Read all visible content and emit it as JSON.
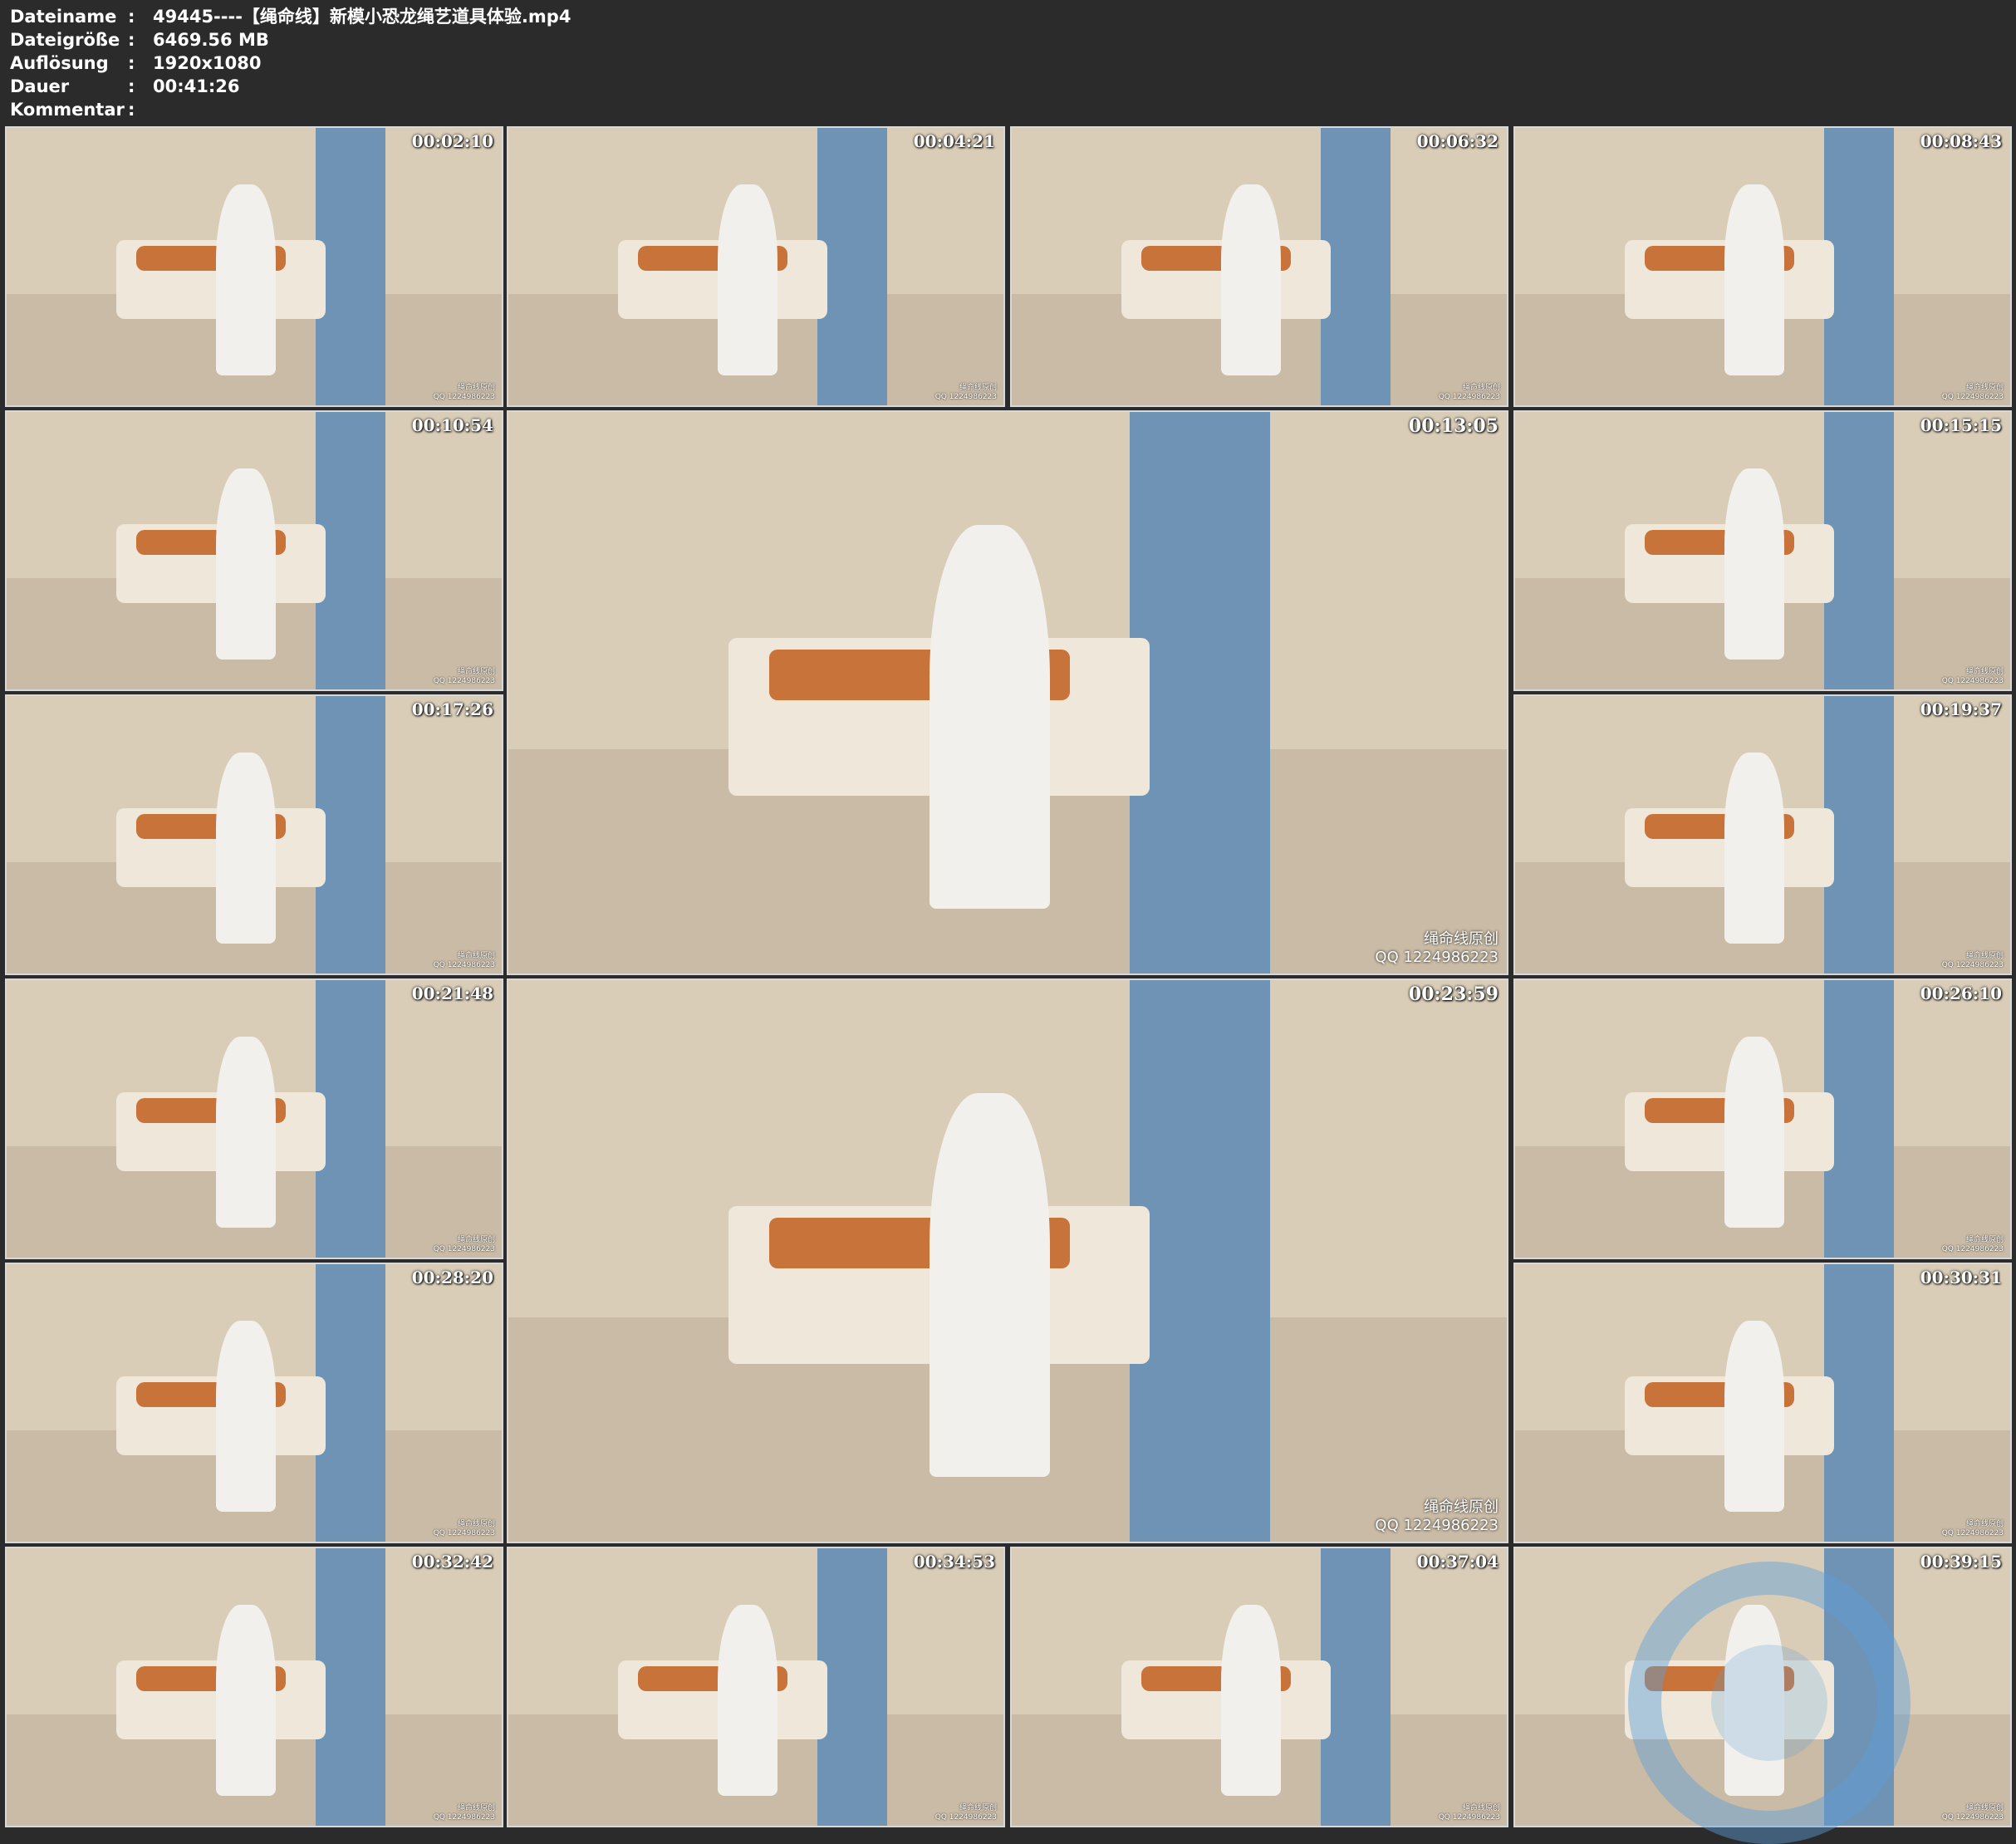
{
  "metadata": {
    "filename_label": "Dateiname",
    "filename_value": "49445----【绳命线】新模小恐龙绳艺道具体验.mp4",
    "filesize_label": "Dateigröße",
    "filesize_value": "6469.56 MB",
    "resolution_label": "Auflösung",
    "resolution_value": "1920x1080",
    "duration_label": "Dauer",
    "duration_value": "00:41:26",
    "comment_label": "Kommentar",
    "comment_value": "",
    "separator": ":"
  },
  "watermark": {
    "name": "绳命线原创",
    "qq": "QQ 1224986223"
  },
  "thumbnails": [
    {
      "timecode": "00:02:10"
    },
    {
      "timecode": "00:04:21"
    },
    {
      "timecode": "00:06:32"
    },
    {
      "timecode": "00:08:43"
    },
    {
      "timecode": "00:10:54"
    },
    {
      "timecode": "00:13:05"
    },
    {
      "timecode": "00:15:15"
    },
    {
      "timecode": "00:17:26"
    },
    {
      "timecode": "00:19:37"
    },
    {
      "timecode": "00:21:48"
    },
    {
      "timecode": "00:23:59"
    },
    {
      "timecode": "00:26:10"
    },
    {
      "timecode": "00:28:20"
    },
    {
      "timecode": "00:30:31"
    },
    {
      "timecode": "00:32:42"
    },
    {
      "timecode": "00:34:53"
    },
    {
      "timecode": "00:37:04"
    },
    {
      "timecode": "00:39:15"
    }
  ],
  "colors": {
    "background": "#2b2b2b",
    "frame_border": "#d8d8d8",
    "wall": "#d9cdb8",
    "floor": "#c9bba6",
    "sofa": "#efe8da",
    "pillow_orange": "#c8733a",
    "curtain_blue": "#6f93b4",
    "figure_white": "#f2f0ec",
    "logo_blue": "#5e9fd9"
  }
}
